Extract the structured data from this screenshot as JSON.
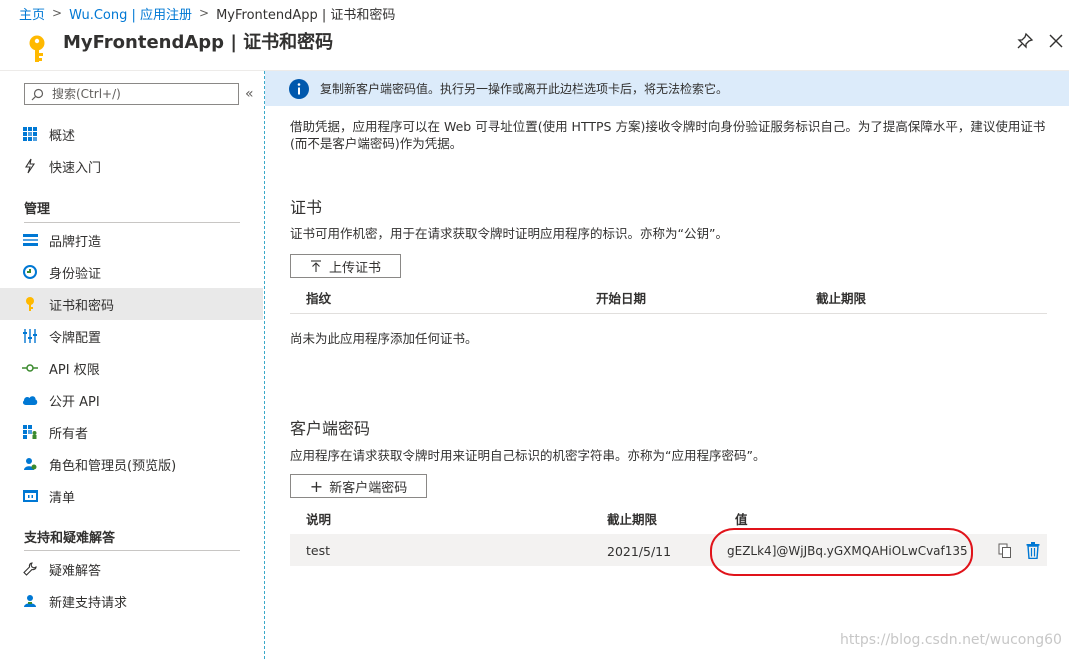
{
  "breadcrumb": {
    "home": "主页",
    "app_registration": "Wu.Cong | 应用注册",
    "current": "MyFrontendApp | 证书和密码"
  },
  "header": {
    "title": "MyFrontendApp | 证书和密码",
    "logo_icon": "key-icon",
    "pin_icon": "pin-icon",
    "close_icon": "close-icon"
  },
  "search": {
    "placeholder": "搜索(Ctrl+/)",
    "collapse_glyph": "«"
  },
  "sidebar": {
    "top_items": [
      {
        "label": "概述",
        "icon": "grid-icon"
      },
      {
        "label": "快速入门",
        "icon": "lightning-icon"
      }
    ],
    "manage_heading": "管理",
    "manage_items": [
      {
        "label": "品牌打造",
        "icon": "branding-icon"
      },
      {
        "label": "身份验证",
        "icon": "authentication-icon"
      },
      {
        "label": "证书和密码",
        "icon": "key-icon",
        "selected": true
      },
      {
        "label": "令牌配置",
        "icon": "token-config-icon"
      },
      {
        "label": "API 权限",
        "icon": "api-permissions-icon"
      },
      {
        "label": "公开 API",
        "icon": "cloud-icon"
      },
      {
        "label": "所有者",
        "icon": "owners-icon"
      },
      {
        "label": "角色和管理员(预览版)",
        "icon": "roles-icon"
      },
      {
        "label": "清单",
        "icon": "manifest-icon"
      }
    ],
    "support_heading": "支持和疑难解答",
    "support_items": [
      {
        "label": "疑难解答",
        "icon": "wrench-icon"
      },
      {
        "label": "新建支持请求",
        "icon": "support-person-icon"
      }
    ]
  },
  "info_bar": {
    "text": "复制新客户端密码值。执行另一操作或离开此边栏选项卡后，将无法检索它。",
    "icon": "info-icon"
  },
  "intro": "借助凭据，应用程序可以在 Web 可寻址位置(使用 HTTPS 方案)接收令牌时向身份验证服务标识自己。为了提高保障水平，建议使用证书(而不是客户端密码)作为凭据。",
  "certificates": {
    "title": "证书",
    "description": "证书可用作机密，用于在请求获取令牌时证明应用程序的标识。亦称为“公钥”。",
    "upload_label": "上传证书",
    "upload_icon": "upload-arrow-icon",
    "columns": [
      "指纹",
      "开始日期",
      "截止期限"
    ],
    "empty_message": "尚未为此应用程序添加任何证书。"
  },
  "client_secrets": {
    "title": "客户端密码",
    "description": "应用程序在请求获取令牌时用来证明自己标识的机密字符串。亦称为“应用程序密码”。",
    "new_label": "新客户端密码",
    "columns": [
      "说明",
      "截止期限",
      "值"
    ],
    "rows": [
      {
        "description": "test",
        "expires": "2021/5/11",
        "value": "gEZLk4]@WjJBq.yGXMQAHiOLwCvaf135"
      }
    ]
  },
  "colors": {
    "accent": "#0078d4",
    "info_bg": "#dcebfa",
    "highlight_oval": "#e0131a"
  },
  "watermark": "https://blog.csdn.net/wucong60"
}
